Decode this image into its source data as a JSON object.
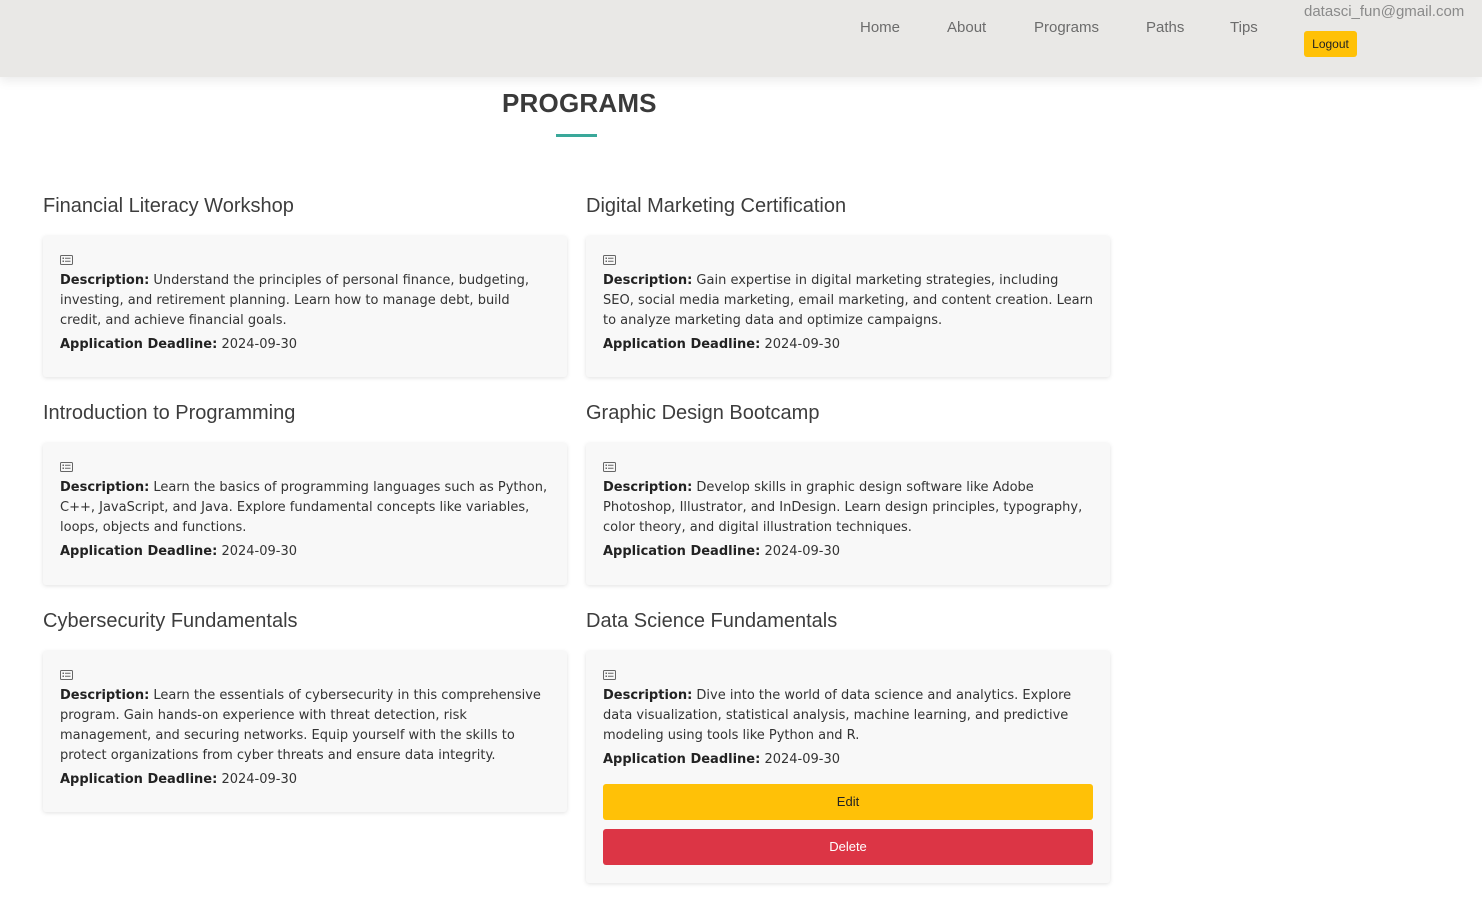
{
  "nav": {
    "links": [
      "Home",
      "About",
      "Programs",
      "Paths",
      "Tips"
    ],
    "user_email": "datasci_fun@gmail.com",
    "logout_label": "Logout"
  },
  "page": {
    "title": "PROGRAMS"
  },
  "labels": {
    "description": "Description:",
    "deadline": "Application Deadline:",
    "edit": "Edit",
    "delete": "Delete"
  },
  "programs": [
    {
      "title": "Financial Literacy Workshop",
      "description": "Understand the principles of personal finance, budgeting, investing, and retirement planning. Learn how to manage debt, build credit, and achieve financial goals.",
      "deadline": "2024-09-30"
    },
    {
      "title": "Digital Marketing Certification",
      "description": "Gain expertise in digital marketing strategies, including SEO, social media marketing, email marketing, and content creation. Learn to analyze marketing data and optimize campaigns.",
      "deadline": "2024-09-30"
    },
    {
      "title": "Introduction to Programming",
      "description": "Learn the basics of programming languages such as Python, C++, JavaScript, and Java. Explore fundamental concepts like variables, loops, objects and functions.",
      "deadline": "2024-09-30"
    },
    {
      "title": "Graphic Design Bootcamp",
      "description": "Develop skills in graphic design software like Adobe Photoshop, Illustrator, and InDesign. Learn design principles, typography, color theory, and digital illustration techniques.",
      "deadline": "2024-09-30"
    },
    {
      "title": "Cybersecurity Fundamentals",
      "description": "Learn the essentials of cybersecurity in this comprehensive program. Gain hands-on experience with threat detection, risk management, and securing networks. Equip yourself with the skills to protect organizations from cyber threats and ensure data integrity.",
      "deadline": "2024-09-30"
    },
    {
      "title": "Data Science Fundamentals",
      "description": "Dive into the world of data science and analytics. Explore data visualization, statistical analysis, machine learning, and predictive modeling using tools like Python and R.",
      "deadline": "2024-09-30"
    }
  ],
  "icons": {
    "card": "card-details-icon"
  },
  "colors": {
    "navbar_bg": "#e9e8e6",
    "accent_teal": "#3aa89a",
    "warning": "#ffc107",
    "danger": "#dc3545"
  }
}
